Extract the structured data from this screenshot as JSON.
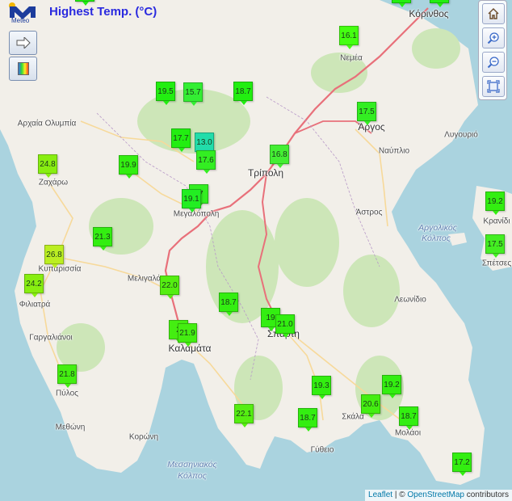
{
  "header": {
    "logo_text": "Meteo",
    "title": "Highest Temp. (°C)"
  },
  "controls": {
    "left": [
      "arrow-right-icon",
      "palette-icon"
    ],
    "right": [
      "home-icon",
      "zoom-in-icon",
      "zoom-out-icon",
      "fullscreen-icon"
    ]
  },
  "attribution": {
    "leaflet": "Leaflet",
    "separator": " | © ",
    "osm": "OpenStreetMap",
    "suffix": " contributors"
  },
  "places": [
    {
      "name": "Κόρινθος"
    },
    {
      "name": "Νεμέα"
    },
    {
      "name": "Αρχαία Ολυμπία"
    },
    {
      "name": "Άργος"
    },
    {
      "name": "Λυγουριό"
    },
    {
      "name": "Ναύπλιο"
    },
    {
      "name": "Ζαχάρω"
    },
    {
      "name": "Τρίπολη"
    },
    {
      "name": "Μεγαλόπολη"
    },
    {
      "name": "Άστρος"
    },
    {
      "name": "Κρανίδι"
    },
    {
      "name": "Αργολικός"
    },
    {
      "name": "Κόλπος"
    },
    {
      "name": "Σπέτσες"
    },
    {
      "name": "Κυπαρισσία"
    },
    {
      "name": "Μελιγαλάς"
    },
    {
      "name": "Φιλιατρά"
    },
    {
      "name": "Λεωνίδιο"
    },
    {
      "name": "Γαργαλιάνοι"
    },
    {
      "name": "Καλαμάτα"
    },
    {
      "name": "Σπάρτη"
    },
    {
      "name": "Πύλος"
    },
    {
      "name": "Σκάλα"
    },
    {
      "name": "Μεθώνη"
    },
    {
      "name": "Μολάοι"
    },
    {
      "name": "Κορώνη"
    },
    {
      "name": "Γύθειο"
    },
    {
      "name": "Μεσσηνιακός"
    },
    {
      "name": "Κόλπος"
    }
  ],
  "stations": [
    {
      "value": "16.1",
      "color": "#44ff11"
    },
    {
      "value": "19.5",
      "color": "#22ee11"
    },
    {
      "value": "15.7",
      "color": "#33ee33"
    },
    {
      "value": "18.7",
      "color": "#22ee11"
    },
    {
      "value": "17.5",
      "color": "#33ee22"
    },
    {
      "value": "17.7",
      "color": "#22ee11"
    },
    {
      "value": "13.0",
      "color": "#22ddaa"
    },
    {
      "value": "17.6",
      "color": "#33ee22"
    },
    {
      "value": "16.8",
      "color": "#44ee33"
    },
    {
      "value": "24.8",
      "color": "#88ee11"
    },
    {
      "value": "19.9",
      "color": "#33ee11"
    },
    {
      "value": "17",
      "color": "#33ee22"
    },
    {
      "value": "19.1",
      "color": "#22ee22"
    },
    {
      "value": "19.2",
      "color": "#33ee11"
    },
    {
      "value": "21.3",
      "color": "#33ee11"
    },
    {
      "value": "17.5",
      "color": "#44ee22"
    },
    {
      "value": "26.8",
      "color": "#bbee22"
    },
    {
      "value": "24.2",
      "color": "#88ee11"
    },
    {
      "value": "22.0",
      "color": "#55ee11"
    },
    {
      "value": "18.7",
      "color": "#33ee11"
    },
    {
      "value": "19",
      "color": "#33ee11"
    },
    {
      "value": "21.0",
      "color": "#33ee11"
    },
    {
      "value": "2",
      "color": "#44ee11"
    },
    {
      "value": "21.9",
      "color": "#44ee11"
    },
    {
      "value": "21.8",
      "color": "#44ee11"
    },
    {
      "value": "19.3",
      "color": "#33ee11"
    },
    {
      "value": "19.2",
      "color": "#33ee11"
    },
    {
      "value": "20.6",
      "color": "#44ee11"
    },
    {
      "value": "18.7",
      "color": "#33ee11"
    },
    {
      "value": "18.7",
      "color": "#33ee11"
    },
    {
      "value": "22.1",
      "color": "#55ee11"
    },
    {
      "value": "17.2",
      "color": "#33ee11"
    }
  ]
}
